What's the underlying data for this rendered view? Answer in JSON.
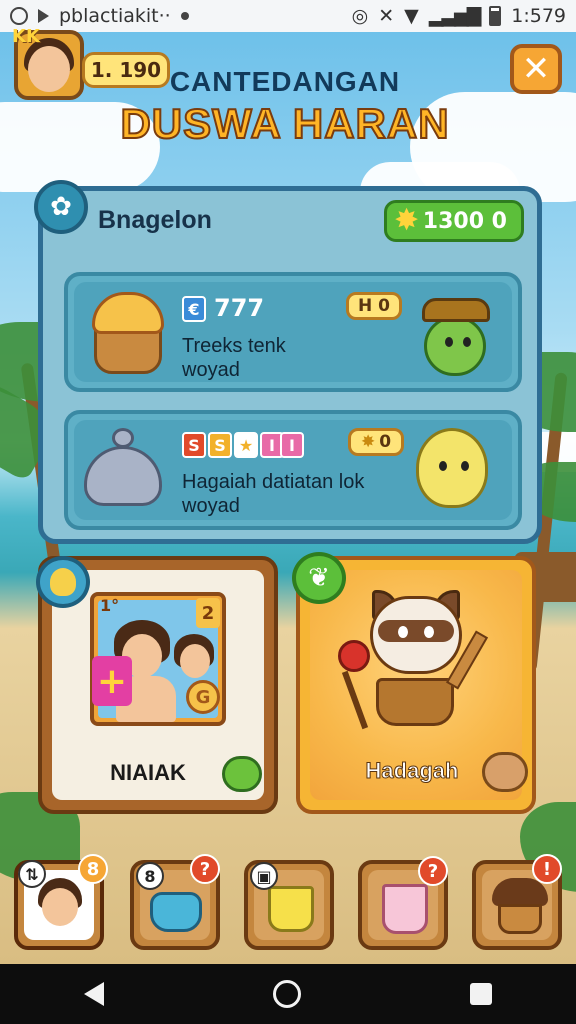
{
  "status_bar": {
    "left_text": "pblactiakit··",
    "time": "1:579"
  },
  "header": {
    "avatar_badge": "KK",
    "coins": "1. 190",
    "title_top": "CANTEDANGAN",
    "title_main": "DUSWA HARAN",
    "close_icon": "close-icon"
  },
  "panel": {
    "title": "Bnagelon",
    "gems": "1300 0",
    "rows": [
      {
        "code": "777",
        "badge": "€",
        "text_line1": "Treeks tenk",
        "text_line2": "woyad",
        "mini_value": "H 0"
      },
      {
        "badges": [
          "S",
          "S",
          "★",
          "I",
          "I"
        ],
        "text_line1": "Hagaiah datiatan lok",
        "text_line2": "woyad",
        "mini_value": "0"
      }
    ]
  },
  "cards": {
    "left": {
      "label": "NIAIAK",
      "corner_left": "1°",
      "corner_right": "2",
      "coin_glyph": "G"
    },
    "right": {
      "label": "Hadagah"
    }
  },
  "tray": {
    "slots": [
      {
        "icon": "girl-avatar-icon",
        "badge": "8",
        "active": true
      },
      {
        "icon": "blue-pot-icon",
        "badge": "?",
        "lock": "8"
      },
      {
        "icon": "yellow-cup-icon",
        "lock": "▣"
      },
      {
        "icon": "pink-cup-icon",
        "badge": "?"
      },
      {
        "icon": "chocolate-cupcake-icon",
        "badge": "!"
      }
    ]
  },
  "colors": {
    "accent_orange": "#f6a634",
    "panel_border": "#2f6d93",
    "gem_green": "#5cbf3a"
  }
}
